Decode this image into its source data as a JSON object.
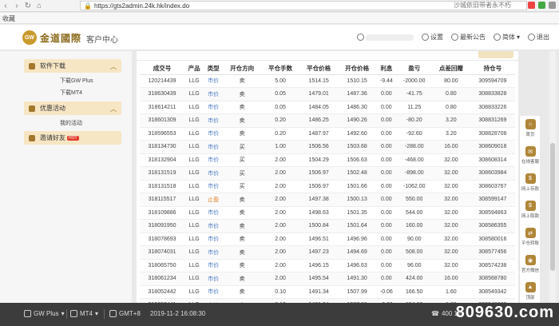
{
  "browser": {
    "url": "https://gts2admin.24k.hk/index.do",
    "right_text": "沙城依旧带者永不朽",
    "bookmark": "收藏"
  },
  "header": {
    "logo_mark": "GW",
    "logo_text": "金道國際",
    "title": "客户中心",
    "settings": "设置",
    "news": "最新公告",
    "language": "简体",
    "logout": "退出"
  },
  "sidebar": {
    "group_software": "软件下载",
    "sub_gwplus": "下载GW Plus",
    "sub_mt4": "下载MT4",
    "group_promo": "优惠活动",
    "sub_my_promo": "我的活动",
    "group_invite": "邀请好友",
    "hot": "HOT"
  },
  "table": {
    "headers": [
      "成交号",
      "产品",
      "类型",
      "开仓方向",
      "平仓手数",
      "平仓价格",
      "开仓价格",
      "利息",
      "盈亏",
      "点差回赠",
      "持仓号"
    ],
    "rows": [
      [
        "120214439",
        "LLG",
        "市价",
        "卖",
        "5.00",
        "1514.15",
        "1510.15",
        "-9.44",
        "-2000.00",
        "80.00",
        "309594709"
      ],
      [
        "318630439",
        "LLG",
        "市价",
        "卖",
        "0.05",
        "1479.01",
        "1487.36",
        "0.00",
        "-41.75",
        "0.80",
        "308833828"
      ],
      [
        "318614211",
        "LLG",
        "市价",
        "卖",
        "0.05",
        "1484.05",
        "1486.30",
        "0.00",
        "11.25",
        "0.80",
        "308833226"
      ],
      [
        "318601309",
        "LLG",
        "市价",
        "卖",
        "0.20",
        "1486.25",
        "1490.26",
        "0.00",
        "-80.20",
        "3.20",
        "308831269"
      ],
      [
        "318596553",
        "LLG",
        "市价",
        "卖",
        "0.20",
        "1487.97",
        "1492.60",
        "0.00",
        "-92.60",
        "3.20",
        "308828708"
      ],
      [
        "318134730",
        "LLG",
        "市价",
        "买",
        "1.00",
        "1506.56",
        "1503.68",
        "0.00",
        "-288.00",
        "16.00",
        "308609018"
      ],
      [
        "318132904",
        "LLG",
        "市价",
        "买",
        "2.00",
        "1504.29",
        "1506.63",
        "0.00",
        "-468.00",
        "32.00",
        "308608314"
      ],
      [
        "318131519",
        "LLG",
        "市价",
        "买",
        "2.00",
        "1506.97",
        "1502.48",
        "0.00",
        "-898.00",
        "32.00",
        "308603984"
      ],
      [
        "318131518",
        "LLG",
        "市价",
        "买",
        "2.00",
        "1506.97",
        "1501.66",
        "0.00",
        "-1062.00",
        "32.00",
        "308603767"
      ],
      [
        "318115517",
        "LLG",
        "止盈",
        "卖",
        "2.00",
        "1497.38",
        "1500.13",
        "0.00",
        "550.00",
        "32.00",
        "308599147"
      ],
      [
        "318109886",
        "LLG",
        "市价",
        "卖",
        "2.00",
        "1498.63",
        "1501.35",
        "0.00",
        "544.00",
        "32.00",
        "308594863"
      ],
      [
        "318091950",
        "LLG",
        "市价",
        "卖",
        "2.00",
        "1500.84",
        "1501.64",
        "0.00",
        "160.00",
        "32.00",
        "308586355"
      ],
      [
        "318078693",
        "LLG",
        "市价",
        "卖",
        "2.00",
        "1496.51",
        "1496.96",
        "0.00",
        "90.00",
        "32.00",
        "308580016"
      ],
      [
        "318074031",
        "LLG",
        "市价",
        "卖",
        "2.00",
        "1497.23",
        "1494.69",
        "0.00",
        "508.00",
        "32.00",
        "308577456"
      ],
      [
        "318065750",
        "LLG",
        "市价",
        "卖",
        "2.00",
        "1496.15",
        "1496.63",
        "0.00",
        "96.00",
        "32.00",
        "308574238"
      ],
      [
        "318061234",
        "LLG",
        "市价",
        "卖",
        "2.00",
        "1495.54",
        "1491.30",
        "0.00",
        "424.00",
        "16.00",
        "308568780"
      ],
      [
        "318052442",
        "LLG",
        "市价",
        "卖",
        "0.10",
        "1491.34",
        "1507.99",
        "-0.06",
        "166.50",
        "1.60",
        "308549342"
      ],
      [
        "318052441",
        "LLG",
        "市价",
        "卖",
        "0.10",
        "1491.34",
        "1507.88",
        "-0.06",
        "154.60",
        "1.60",
        "308548669"
      ]
    ]
  },
  "float_panel": [
    "首页",
    "在线客服",
    "网上存款",
    "网上取款",
    "平仓转账",
    "官方微信",
    "顶部"
  ],
  "footer": {
    "gw_plus": "GW Plus",
    "mt4": "MT4",
    "timezone": "GMT+8",
    "datetime": "2019-11-2 16:08:30",
    "phone": "400 12",
    "watermark": "809630.com"
  },
  "colors": {
    "gold": "#b08639",
    "gold_light": "#f7e6c4",
    "footer_bg": "#3c3c3c"
  }
}
